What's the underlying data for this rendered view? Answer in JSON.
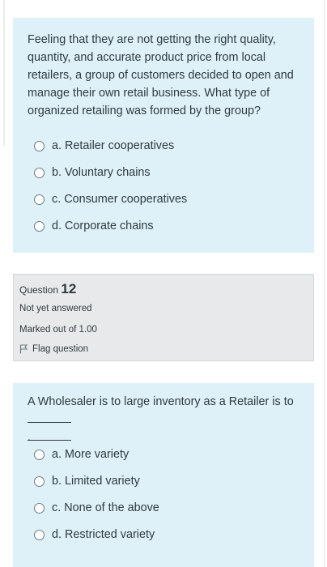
{
  "question11": {
    "text": "Feeling that they are not getting the right quality, quantity, and accurate product price from local retailers, a group of customers decided to open and manage their own retail business. What type of organized retailing was formed by the group?",
    "options": [
      {
        "label": "a. Retailer cooperatives"
      },
      {
        "label": "b. Voluntary chains"
      },
      {
        "label": "c. Consumer cooperatives"
      },
      {
        "label": "d. Corporate chains"
      }
    ]
  },
  "question12": {
    "info": {
      "prefix": "Question",
      "number": "12",
      "state": "Not yet answered",
      "grade": "Marked out of 1.00",
      "flag_label": "Flag question",
      "flag_icon": "flag-icon"
    },
    "text": "A Wholesaler is to large inventory as a Retailer is to",
    "blank_suffix": ".",
    "options": [
      {
        "label": "a. More variety"
      },
      {
        "label": "b. Limited variety"
      },
      {
        "label": "c. None of the above"
      },
      {
        "label": "d. Restricted variety"
      }
    ]
  }
}
